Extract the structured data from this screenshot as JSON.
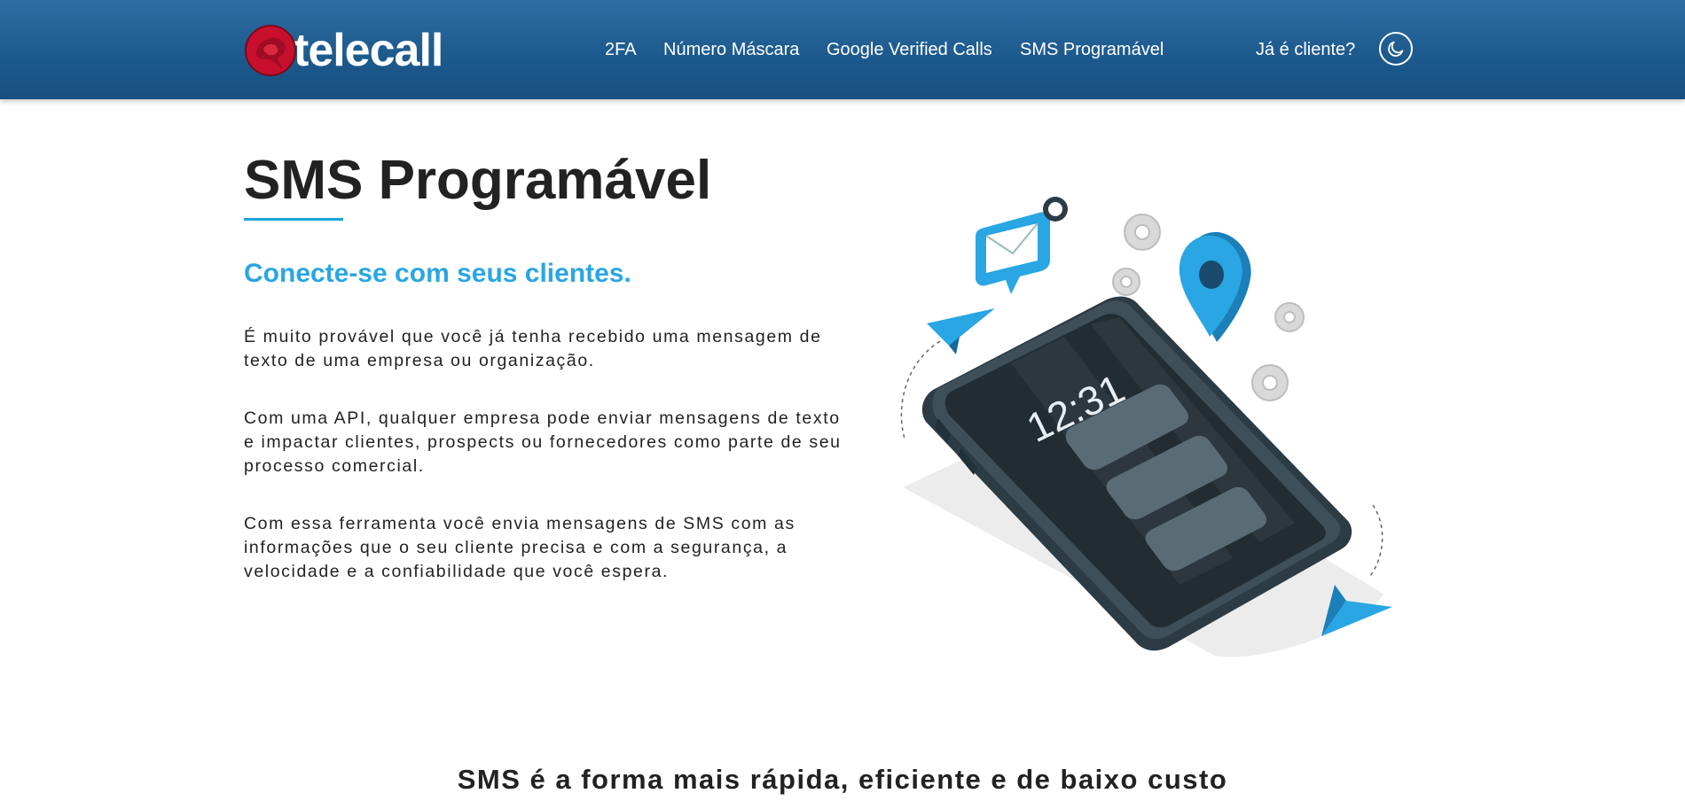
{
  "brand": {
    "name": "telecall",
    "colors": {
      "header": "#1d5a8e",
      "accent": "#29a6e3",
      "logo_red": "#c8102e"
    }
  },
  "nav": {
    "items": [
      {
        "label": "2FA"
      },
      {
        "label": "Número Máscara"
      },
      {
        "label": "Google Verified Calls"
      },
      {
        "label": "SMS Programável"
      }
    ],
    "client_link": "Já é cliente?",
    "theme_toggle_icon": "moon-icon"
  },
  "hero": {
    "title": "SMS Programável",
    "subtitle": "Conecte-se com seus clientes.",
    "paragraphs": [
      "É muito provável que você já tenha recebido uma mensagem de texto de uma empresa ou organização.",
      "Com uma API, qualquer empresa pode enviar mensagens de texto e impactar clientes, prospects ou fornecedores como parte de seu processo comercial.",
      "Com essa ferramenta você envia mensagens de SMS com as informações que o seu cliente precisa e com a segurança, a velocidade e a confiabilidade que você espera."
    ],
    "illustration": {
      "phone_time": "12:31",
      "icons": [
        "smartphone-icon",
        "message-bubble-icon",
        "location-pin-icon",
        "gear-icon",
        "paper-plane-icon"
      ]
    }
  },
  "section": {
    "heading": "SMS é a forma mais rápida, eficiente e de baixo custo"
  }
}
